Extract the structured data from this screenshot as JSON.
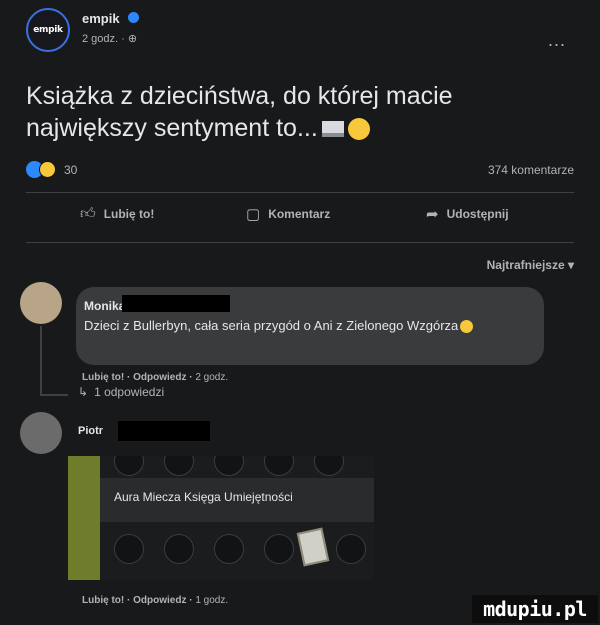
{
  "post": {
    "author": "empik",
    "avatar_text": "empik",
    "meta": "2 godz. · ⊕",
    "more": "...",
    "text": "Książka z dzieciństwa, do której macie największy sentyment to...",
    "reaction_count": "30",
    "comment_count": "374 komentarze"
  },
  "actions": {
    "like": "Lubię to!",
    "comment": "Komentarz",
    "share": "Udostępnij",
    "like_icon": "thumbs-up-icon",
    "comment_icon": "speech-bubble-icon",
    "share_icon": "share-arrow-icon"
  },
  "comments": {
    "sort_label": "Najtrafniejsze ▾",
    "first": {
      "author": "Monika",
      "text": "Dzieci z Bullerbyn, cała seria przygód o Ani z Zielonego Wzgórza",
      "like": "Lubię to!",
      "reply": "Odpowiedz",
      "time": "2 godz.",
      "replies_link": "1 odpowiedzi"
    },
    "second": {
      "author": "Piotr",
      "image_title": "Aura Miecza Księga Umiejętności",
      "like": "Lubię to!",
      "reply": "Odpowiedz",
      "time": "1 godz."
    }
  },
  "watermark": "mdupiu.pl",
  "colors": {
    "background": "#18191a",
    "bubble": "#3a3b3c",
    "text": "#e4e6eb",
    "secondary": "#b0b3b8",
    "accent": "#2d88ff"
  }
}
